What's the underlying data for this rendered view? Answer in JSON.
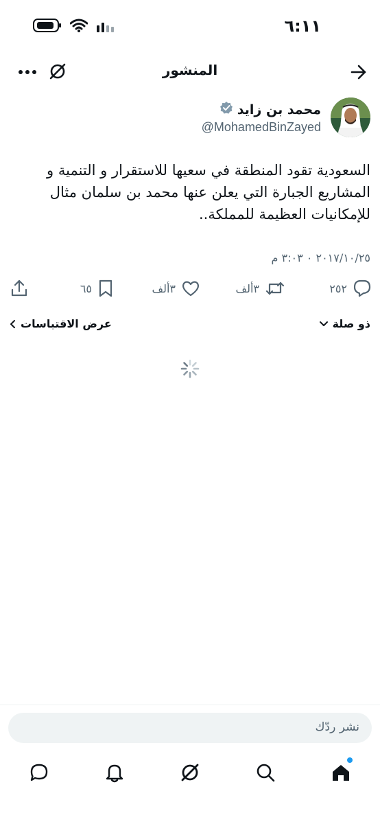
{
  "status_bar": {
    "time": "٦:١١"
  },
  "header": {
    "title": "المنشور"
  },
  "author": {
    "name": "محمد بن زايد",
    "handle": "@MohamedBinZayed"
  },
  "tweet": {
    "text": "السعودية تقود المنطقة في سعيها للاستقرار و التنمية و المشاريع الجبارة التي يعلن عنها محمد بن سلمان مثال للإمكانيات العظيمة للمملكة..",
    "timestamp": "٢٠١٧/١٠/٢٥ ٠ ٣:٠٣ م"
  },
  "actions": {
    "replies": "٢٥٢",
    "reposts": "٣ألف",
    "likes": "٣ألف",
    "bookmarks": "٦٥"
  },
  "relevance": {
    "sort_label": "ذو صلة",
    "quotes_label": "عرض الاقتباسات"
  },
  "reply_box": {
    "placeholder": "نشر ردّك"
  },
  "colors": {
    "accent": "#1d9bf0",
    "text": "#0f1419",
    "muted": "#536471",
    "input_bg": "#eff3f4"
  },
  "icons": [
    "back-arrow-icon",
    "grok-icon",
    "more-icon",
    "verified-icon",
    "reply-icon",
    "repost-icon",
    "like-icon",
    "bookmark-icon",
    "share-icon",
    "chevron-down-icon",
    "chevron-left-icon",
    "home-icon",
    "search-icon",
    "notifications-icon",
    "messages-icon"
  ]
}
